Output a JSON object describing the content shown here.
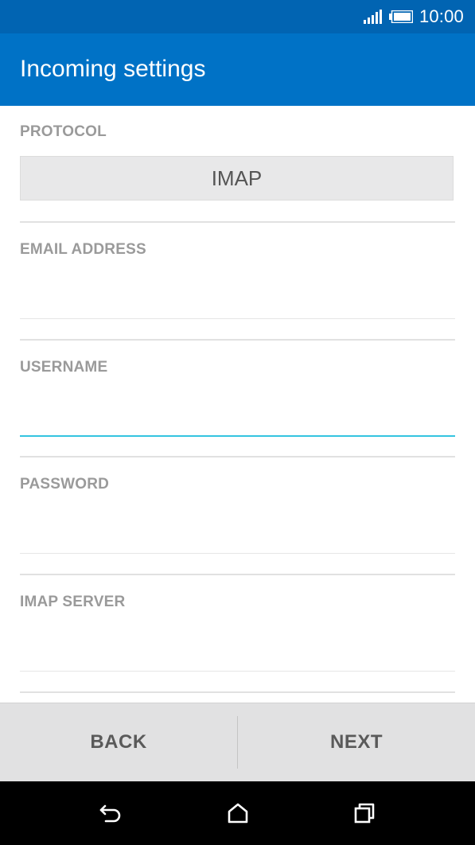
{
  "status_bar": {
    "time": "10:00",
    "icons": [
      "signal-icon",
      "battery-icon"
    ]
  },
  "app_bar": {
    "title": "Incoming settings"
  },
  "form": {
    "protocol": {
      "label": "PROTOCOL",
      "value": "IMAP"
    },
    "email": {
      "label": "EMAIL ADDRESS",
      "value": "",
      "placeholder": ""
    },
    "username": {
      "label": "USERNAME",
      "value": "",
      "placeholder": "",
      "focused": true
    },
    "password": {
      "label": "PASSWORD",
      "value": "",
      "placeholder": ""
    },
    "server": {
      "label": "IMAP SERVER",
      "value": "",
      "placeholder": ""
    }
  },
  "buttons": {
    "back": "BACK",
    "next": "NEXT"
  },
  "nav_bar": {
    "icons": [
      "back-icon",
      "home-icon",
      "recents-icon"
    ]
  },
  "colors": {
    "status_bar": "#0164b2",
    "app_bar": "#0072c6",
    "focus_accent": "#34c4e0",
    "label": "#9a9a9a",
    "button_bar": "#e1e1e2"
  }
}
